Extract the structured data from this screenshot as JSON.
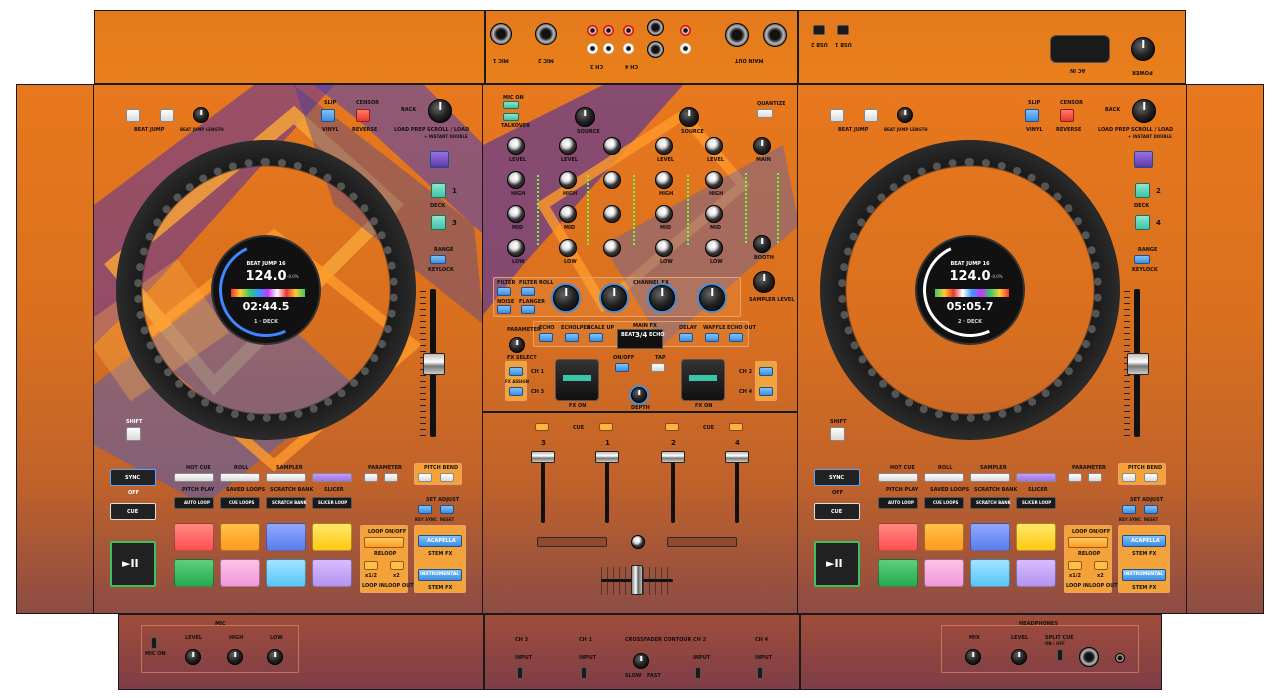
{
  "rear_panel": {
    "inputs": [
      "MIC 1",
      "MIC 2",
      "CH 3",
      "CH 4",
      "MAIN OUT"
    ],
    "switches": [
      "PHONO",
      "LINE",
      "PHONO",
      "LINE"
    ],
    "usb": [
      "USB 2",
      "USB 1"
    ],
    "ac": "AC IN",
    "power": "POWER"
  },
  "left_deck": {
    "beat_jump": "BEAT JUMP",
    "beat_jump_length": "BEAT JUMP LENGTH",
    "slip": "SLIP",
    "vinyl": "VINYL",
    "censor": "CENSOR",
    "reverse": "REVERSE",
    "back": "BACK",
    "load_prep": "LOAD PREP",
    "scroll_load": "SCROLL / LOAD",
    "instant_double": "+ INSTANT DOUBLE",
    "deck_label": "DECK",
    "deck_numbers": [
      "1",
      "3"
    ],
    "range": "RANGE",
    "keylock": "KEYLOCK",
    "shift": "SHIFT",
    "sync": "SYNC",
    "off": "OFF",
    "cue": "CUE",
    "play": "►II",
    "mode_buttons": [
      "HOT CUE",
      "ROLL",
      "SAMPLER",
      "",
      ""
    ],
    "mode_sub": [
      "PITCH PLAY",
      "SAVED LOOPS",
      "SCRATCH BANK",
      "SLICER"
    ],
    "mode_dark": [
      "AUTO LOOP",
      "CUE LOOPS",
      "SCRATCH BANK",
      "SLICER LOOP"
    ],
    "parameter": "PARAMETER",
    "pitch_bend": "PITCH BEND",
    "set_adjust": "SET ADJUST",
    "key_sync": "KEY SYNC",
    "reset": "RESET",
    "loop_onoff": "LOOP ON/OFF",
    "reloop": "RELOOP",
    "loop_half": "x1/2",
    "loop_double": "x2",
    "loop_in": "LOOP IN",
    "loop_out": "LOOP OUT",
    "acapella": "ACAPELLA",
    "stem_fx": "STEM FX",
    "instrumental": "INSTRUMENTAL",
    "stem_fx2": "STEM FX",
    "screen": {
      "title": "BEAT JUMP 16",
      "bpm": "124.0",
      "offset": "-0.0%",
      "time": "02:44.5",
      "deck": "1 · DECK"
    }
  },
  "right_deck": {
    "deck_numbers": [
      "2",
      "4"
    ],
    "screen": {
      "title": "BEAT JUMP 16",
      "bpm": "124.0",
      "offset": "-0.0%",
      "time": "05:05.7",
      "deck": "2 · DECK"
    }
  },
  "mixer": {
    "mic_on": "MIC ON",
    "talkover": "TALKOVER",
    "quantize": "QUANTIZE",
    "source": "SOURCE",
    "cue_mix": "CUE MIX",
    "level": "LEVEL",
    "gain": "GAIN",
    "high": "HIGH",
    "mid": "MID",
    "low": "LOW",
    "main": "MAIN",
    "booth": "BOOTH",
    "echo": "ECHO",
    "reverb": "REVERB",
    "filter": "FILTER",
    "filter_roll": "FILTER ROLL",
    "noise": "NOISE",
    "flanger": "FLANGER",
    "channel_fx": "CHANNEL FX",
    "main_fx": "MAIN FX",
    "parameter": "PARAMETER",
    "fx_select": "FX SELECT",
    "fx_names": [
      "ECHO",
      "ECHOLPER",
      "SCALE UP",
      "DELAY",
      "WAFFLE",
      "ECHO OUT"
    ],
    "on_off": "ON/OFF",
    "tap": "TAP",
    "fx_assign": "FX ASSIGN",
    "ch_labels": [
      "CH 1",
      "CH 3",
      "CH 2",
      "CH 4"
    ],
    "fx_on": "FX ON",
    "depth": "DEPTH",
    "sampler_level": "SAMPLER LEVEL",
    "cue": "CUE",
    "display": [
      "BEAT",
      "3/4",
      "ECHO"
    ],
    "channel_numbers": [
      "3",
      "1",
      "2",
      "4"
    ]
  },
  "bottom": {
    "mic": "MIC",
    "mic_on": "MIC ON",
    "level": "LEVEL",
    "high": "HIGH",
    "low": "LOW",
    "ch_labels": [
      "CH 3",
      "CH 1",
      "CH 2",
      "CH 4"
    ],
    "input": "INPUT",
    "crossfader": "CROSSFADER CONTOUR",
    "slow": "SLOW",
    "fast": "FAST",
    "headphones": "HEADPHONES",
    "cue_mix": "MIX",
    "split_cue": "SPLIT CUE",
    "on_off": "ON / OFF"
  },
  "colors": {
    "orange": "#e8781d",
    "purple": "#6b2fa8",
    "blue": "#3e8fe0",
    "pad_red": "#ff5e5e",
    "pad_orange": "#ffa020",
    "pad_blue": "#6e8cff",
    "pad_yellow": "#ffd21a",
    "pad_green": "#2fc060",
    "pad_pink": "#ff9ee0",
    "pad_sky": "#6ed0ff",
    "pad_lilac": "#c89cff"
  }
}
